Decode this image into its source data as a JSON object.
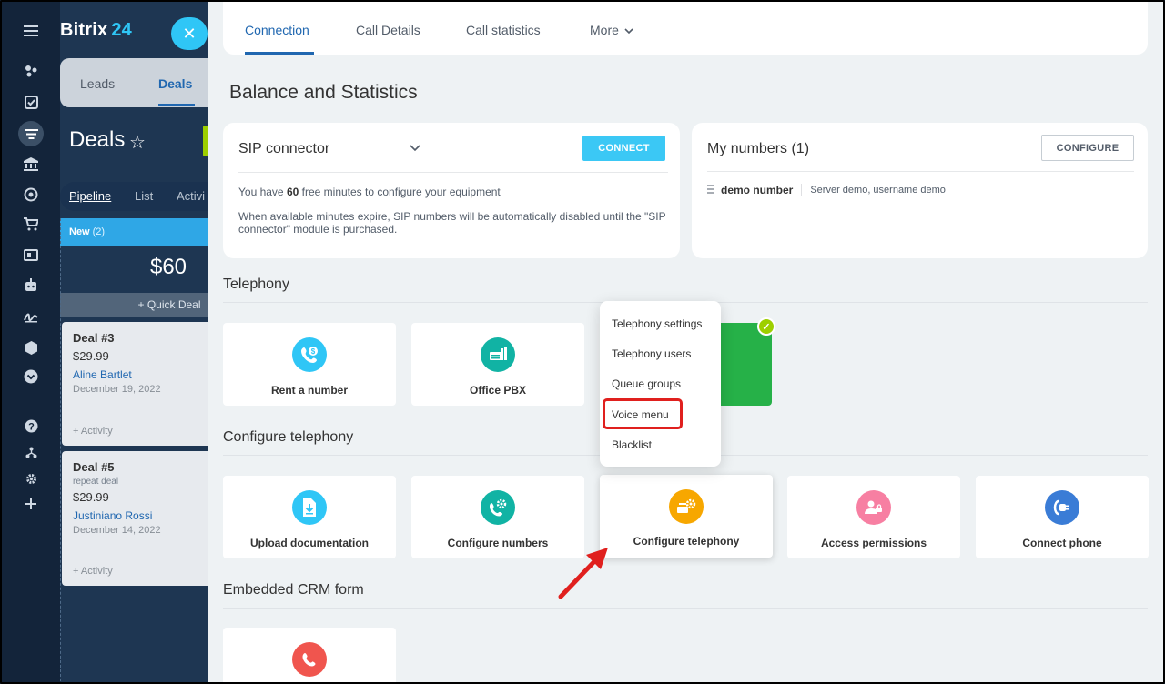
{
  "rail": {
    "icons": [
      "menu-icon",
      "feed-icon",
      "tasks-icon",
      "crm-icon",
      "bank-icon",
      "target-icon",
      "cart-icon",
      "contact-card-icon",
      "robot-icon",
      "sign-icon",
      "box-icon",
      "chevron-circle-icon",
      "help-icon",
      "sitemap-icon",
      "settings-icon",
      "plus-icon"
    ]
  },
  "crm": {
    "brand_name": "Bitrix",
    "brand_num": "24",
    "close_symbol": "✕",
    "tabs": [
      "Leads",
      "Deals"
    ],
    "title": "Deals",
    "view_tabs": [
      "Pipeline",
      "List",
      "Activi"
    ],
    "stage": {
      "name": "New",
      "count": "(2)",
      "sum": "$60"
    },
    "quick_deal": "+ Quick Deal",
    "cards": [
      {
        "title": "Deal #3",
        "sub": "",
        "price": "$29.99",
        "contact": "Aline Bartlet",
        "date": "December 19, 2022",
        "activity": "+ Activity"
      },
      {
        "title": "Deal #5",
        "sub": "repeat deal",
        "price": "$29.99",
        "contact": "Justiniano Rossi",
        "date": "December 14, 2022",
        "activity": "+ Activity"
      }
    ]
  },
  "nav": {
    "tabs": [
      "Connection",
      "Call Details",
      "Call statistics",
      "More"
    ],
    "active": "Connection"
  },
  "balance": {
    "heading": "Balance and Statistics",
    "sip": {
      "title": "SIP connector",
      "connect_label": "CONNECT",
      "line1_pre": "You have ",
      "line1_num": "60",
      "line1_post": " free minutes to configure your equipment",
      "line2": "When available minutes expire, SIP numbers will be automatically disabled until the \"SIP connector\" module is purchased."
    },
    "numbers": {
      "title": "My numbers (1)",
      "configure_label": "CONFIGURE",
      "number_name": "demo number",
      "number_info": "Server demo, username demo"
    }
  },
  "telephony": {
    "heading": "Telephony",
    "tiles": [
      {
        "label": "Rent a number",
        "icon": "phone-dollar-icon",
        "color": "#2fc6f6"
      },
      {
        "label": "Office PBX",
        "icon": "pbx-icon",
        "color": "#11b3a4"
      }
    ]
  },
  "popup": {
    "items": [
      "Telephony settings",
      "Telephony users",
      "Queue groups",
      "Voice menu",
      "Blacklist"
    ],
    "highlighted": "Voice menu"
  },
  "configure": {
    "heading": "Configure telephony",
    "tiles": [
      {
        "label": "Upload documentation",
        "icon": "download-doc-icon",
        "color": "#2fc6f6"
      },
      {
        "label": "Configure numbers",
        "icon": "phone-gear-icon",
        "color": "#11b3a4"
      },
      {
        "label": "Configure telephony",
        "icon": "telephony-gear-icon",
        "color": "#f7a700"
      },
      {
        "label": "Access permissions",
        "icon": "user-lock-icon",
        "color": "#f77fa2"
      },
      {
        "label": "Connect phone",
        "icon": "plug-icon",
        "color": "#3a7cd6"
      }
    ]
  },
  "crm_form": {
    "heading": "Embedded CRM form",
    "tile_icon": "phone-red-icon",
    "tile_color": "#f0554e"
  },
  "colors": {
    "accent": "#2067b0",
    "highlight": "#e0201e"
  }
}
